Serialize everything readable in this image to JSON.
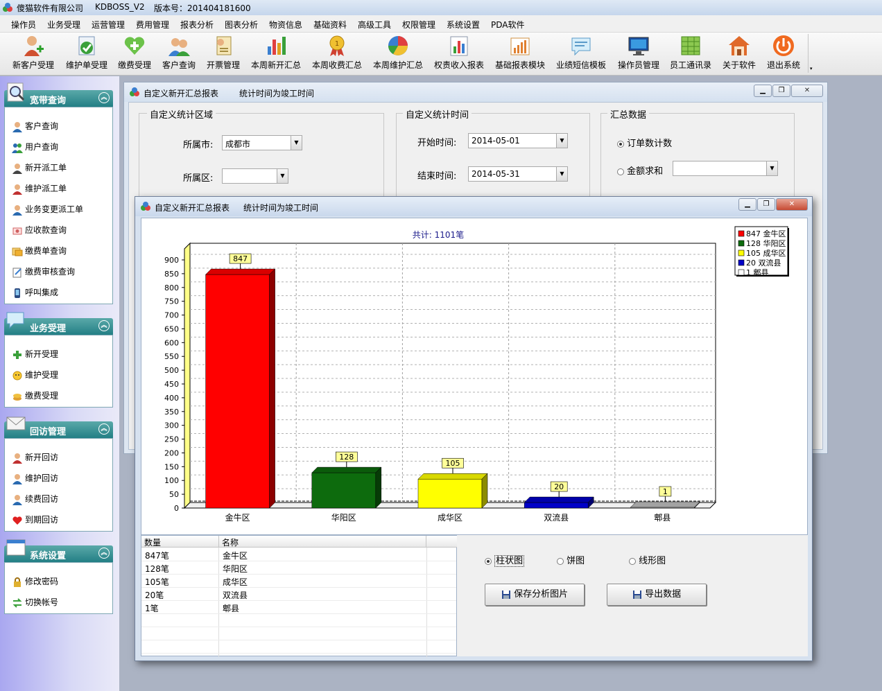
{
  "app": {
    "company": "傻猫软件有限公司",
    "product": "KDBOSS_V2",
    "version": "版本号：201404181600"
  },
  "menu": [
    "操作员",
    "业务受理",
    "运营管理",
    "费用管理",
    "报表分析",
    "图表分析",
    "物资信息",
    "基础资料",
    "高级工具",
    "权限管理",
    "系统设置",
    "PDA软件"
  ],
  "toolbar": [
    {
      "label": "新客户受理",
      "icon": "new-customer-icon"
    },
    {
      "label": "维护单受理",
      "icon": "maintenance-order-icon"
    },
    {
      "label": "缴费受理",
      "icon": "payment-heart-icon"
    },
    {
      "label": "客户查询",
      "icon": "customer-query-icon"
    },
    {
      "label": "开票管理",
      "icon": "invoice-icon"
    },
    {
      "label": "本周新开汇总",
      "icon": "weekly-new-summary-icon"
    },
    {
      "label": "本周收费汇总",
      "icon": "weekly-fee-medal-icon"
    },
    {
      "label": "本周维护汇总",
      "icon": "weekly-maintenance-pie-icon"
    },
    {
      "label": "权责收入报表",
      "icon": "revenue-report-icon"
    },
    {
      "label": "基础报表模块",
      "icon": "basic-report-icon"
    },
    {
      "label": "业绩短信模板",
      "icon": "sms-template-icon"
    },
    {
      "label": "操作员管理",
      "icon": "operator-monitor-icon"
    },
    {
      "label": "员工通讯录",
      "icon": "staff-directory-icon"
    },
    {
      "label": "关于软件",
      "icon": "home-icon"
    },
    {
      "label": "退出系统",
      "icon": "power-icon"
    }
  ],
  "sidebar": [
    {
      "title": "宽带查询",
      "items": [
        "客户查询",
        "用户查询",
        "新开派工单",
        "维护派工单",
        "业务变更派工单",
        "应收款查询",
        "缴费单查询",
        "缴费审核查询",
        "呼叫集成"
      ]
    },
    {
      "title": "业务受理",
      "items": [
        "新开受理",
        "维护受理",
        "缴费受理"
      ]
    },
    {
      "title": "回访管理",
      "items": [
        "新开回访",
        "维护回访",
        "续费回访",
        "到期回访"
      ]
    },
    {
      "title": "系统设置",
      "items": [
        "修改密码",
        "切换帐号"
      ]
    }
  ],
  "win1": {
    "title": "自定义新开汇总报表",
    "subtitle": "统计时间为竣工时间",
    "region_group": "自定义统计区域",
    "city_label": "所属市:",
    "city_value": "成都市",
    "district_label": "所属区:",
    "district_value": "",
    "time_group": "自定义统计时间",
    "start_label": "开始时间:",
    "start_value": "2014-05-01",
    "end_label": "结束时间:",
    "end_value": "2014-05-31",
    "summary_group": "汇总数据",
    "opt_count": "订单数计数",
    "opt_sum": "金额求和",
    "selected": "订单数计数"
  },
  "win2": {
    "title": "自定义新开汇总报表",
    "subtitle": "统计时间为竣工时间",
    "grid_headers": [
      "数量",
      "名称"
    ],
    "grid_rows": [
      [
        "847笔",
        "金牛区"
      ],
      [
        "128笔",
        "华阳区"
      ],
      [
        "105笔",
        "成华区"
      ],
      [
        "20笔",
        "双流县"
      ],
      [
        "1笔",
        "郫县"
      ]
    ],
    "chart_types": [
      "柱状图",
      "饼图",
      "线形图"
    ],
    "selected_chart_type": "柱状图",
    "save_button": "保存分析图片",
    "export_button": "导出数据"
  },
  "chart_data": {
    "type": "bar",
    "title": "共计: 1101笔",
    "categories": [
      "金牛区",
      "华阳区",
      "成华区",
      "双流县",
      "郫县"
    ],
    "values": [
      847,
      128,
      105,
      20,
      1
    ],
    "colors": [
      "#ff0000",
      "#0d6b0d",
      "#ffff00",
      "#0000c8",
      "#ffffff"
    ],
    "legend": [
      "847 金牛区",
      "128 华阳区",
      "105 成华区",
      "20 双流县",
      "1 郫县"
    ],
    "legend_position": "top-right",
    "ylim": [
      0,
      900
    ],
    "yticks": [
      0,
      50,
      100,
      150,
      200,
      250,
      300,
      350,
      400,
      450,
      500,
      550,
      600,
      650,
      700,
      750,
      800,
      850,
      900
    ],
    "grid": true
  }
}
